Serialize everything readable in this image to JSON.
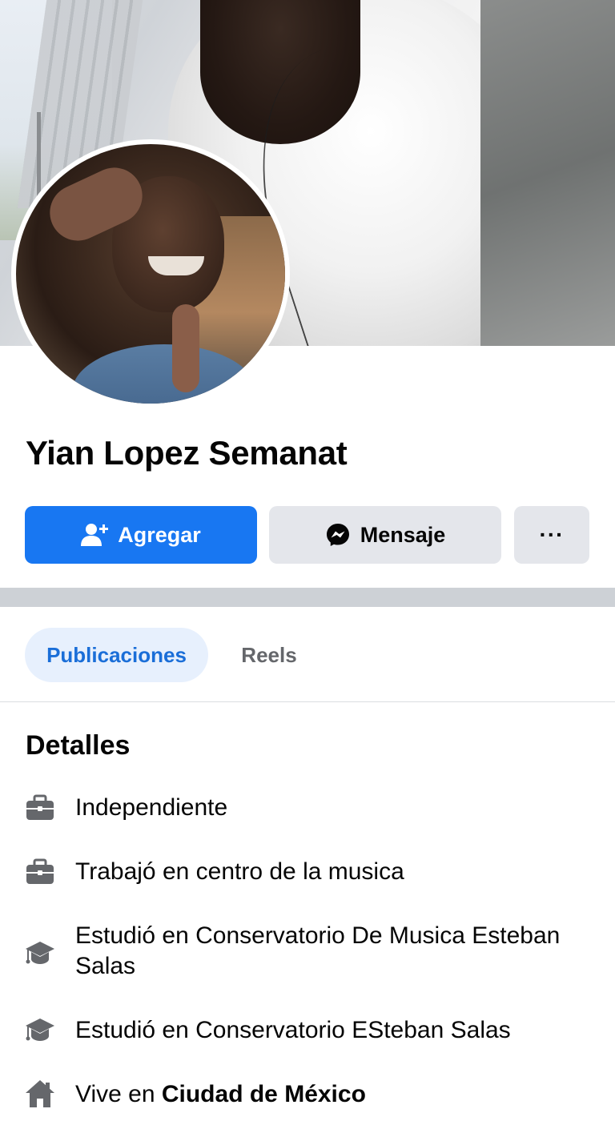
{
  "profile": {
    "name": "Yian Lopez Semanat"
  },
  "actions": {
    "add_label": "Agregar",
    "message_label": "Mensaje",
    "more_label": "···"
  },
  "tabs": [
    {
      "label": "Publicaciones",
      "active": true
    },
    {
      "label": "Reels",
      "active": false
    }
  ],
  "details": {
    "title": "Detalles",
    "items": [
      {
        "icon": "briefcase-icon",
        "text": "Independiente"
      },
      {
        "icon": "briefcase-icon",
        "text": "Trabajó en centro de la musica"
      },
      {
        "icon": "graduation-cap-icon",
        "text": "Estudió en Conservatorio De Musica Esteban Salas"
      },
      {
        "icon": "graduation-cap-icon",
        "text": "Estudió en Conservatorio ESteban Salas"
      },
      {
        "icon": "home-icon",
        "prefix": "Vive en ",
        "place": "Ciudad de México"
      }
    ]
  },
  "colors": {
    "primary": "#1877f2",
    "secondary_button": "#e4e6eb",
    "active_tab_bg": "#e7f0fd",
    "active_tab_text": "#1a6ed8",
    "icon_gray": "#65676b"
  }
}
